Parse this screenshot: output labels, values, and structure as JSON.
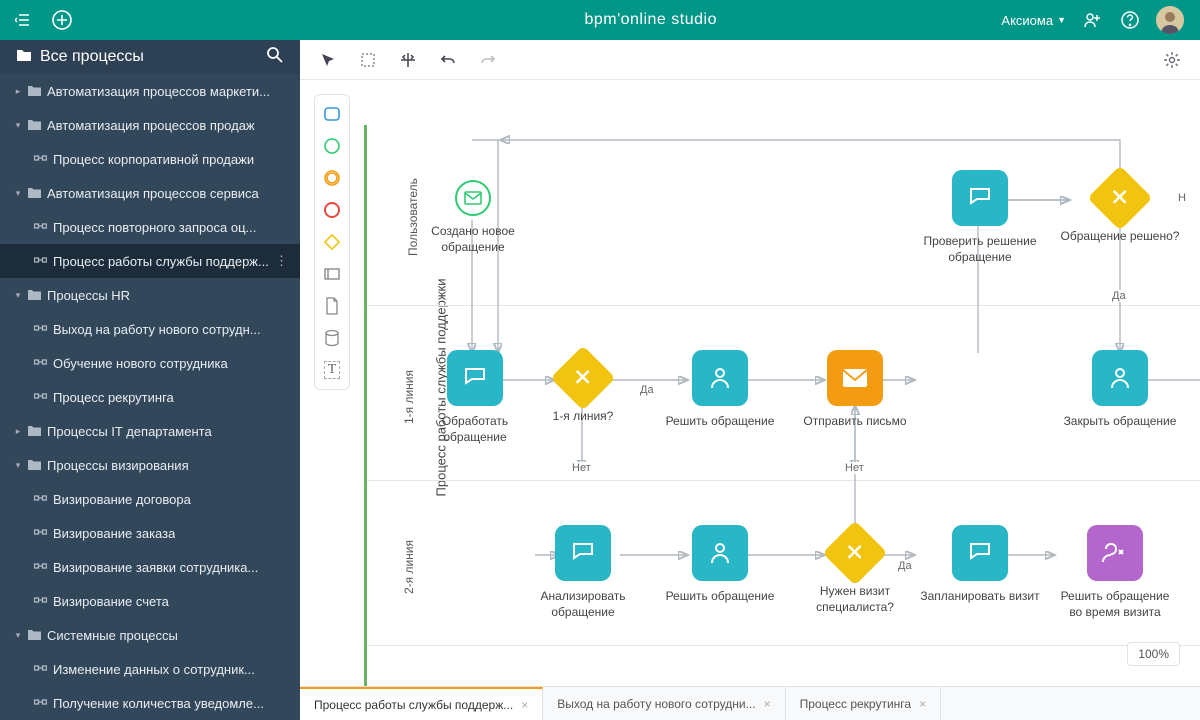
{
  "topbar": {
    "title": "bpm'online studio",
    "tenant": "Аксиома"
  },
  "sidebar": {
    "title": "Все процессы",
    "groups": [
      {
        "label": "Автоматизация процессов маркети...",
        "expanded": false,
        "children": []
      },
      {
        "label": "Автоматизация процессов продаж",
        "expanded": true,
        "children": [
          {
            "label": "Процесс корпоративной продажи"
          }
        ]
      },
      {
        "label": "Автоматизация процессов сервиса",
        "expanded": true,
        "children": [
          {
            "label": "Процесс повторного запроса оц..."
          },
          {
            "label": "Процесс работы службы поддерж...",
            "selected": true
          }
        ]
      },
      {
        "label": "Процессы HR",
        "expanded": true,
        "children": [
          {
            "label": "Выход на работу нового сотрудн..."
          },
          {
            "label": "Обучение нового сотрудника"
          },
          {
            "label": "Процесс рекрутинга"
          }
        ]
      },
      {
        "label": "Процессы IT департамента",
        "expanded": false,
        "children": []
      },
      {
        "label": "Процессы визирования",
        "expanded": true,
        "children": [
          {
            "label": "Визирование договора"
          },
          {
            "label": "Визирование заказа"
          },
          {
            "label": "Визирование заявки сотрудника..."
          },
          {
            "label": "Визирование счета"
          }
        ]
      },
      {
        "label": "Системные процессы",
        "expanded": true,
        "children": [
          {
            "label": "Изменение данных о сотрудник..."
          },
          {
            "label": "Получение количества уведомле..."
          }
        ]
      }
    ]
  },
  "pool": {
    "label": "Процесс работы службы поддержки"
  },
  "lanes": [
    {
      "label": "Пользователь"
    },
    {
      "label": "1-я линия"
    },
    {
      "label": "2-я линия"
    }
  ],
  "nodes": {
    "start": {
      "label": "Создано новое обращение"
    },
    "handle": {
      "label": "Обработать обращение"
    },
    "g1": {
      "label": "1-я линия?"
    },
    "solve1": {
      "label": "Решить обращение"
    },
    "mail": {
      "label": "Отправить письмо"
    },
    "check": {
      "label": "Проверить решение обращение"
    },
    "g2": {
      "label": "Обращение решено?"
    },
    "close": {
      "label": "Закрыть обращение"
    },
    "analyze": {
      "label": "Анализировать обращение"
    },
    "solve2": {
      "label": "Решить обращение"
    },
    "g3": {
      "label": "Нужен визит специалиста?"
    },
    "plan": {
      "label": "Запланировать визит"
    },
    "visit": {
      "label": "Решить обращение во время визита"
    }
  },
  "edges": {
    "yes": "Да",
    "no": "Нет",
    "no2": "Н"
  },
  "zoom": "100%",
  "tabs": [
    {
      "label": "Процесс работы службы поддерж...",
      "active": true
    },
    {
      "label": "Выход на работу нового сотрудни..."
    },
    {
      "label": "Процесс рекрутинга"
    }
  ]
}
